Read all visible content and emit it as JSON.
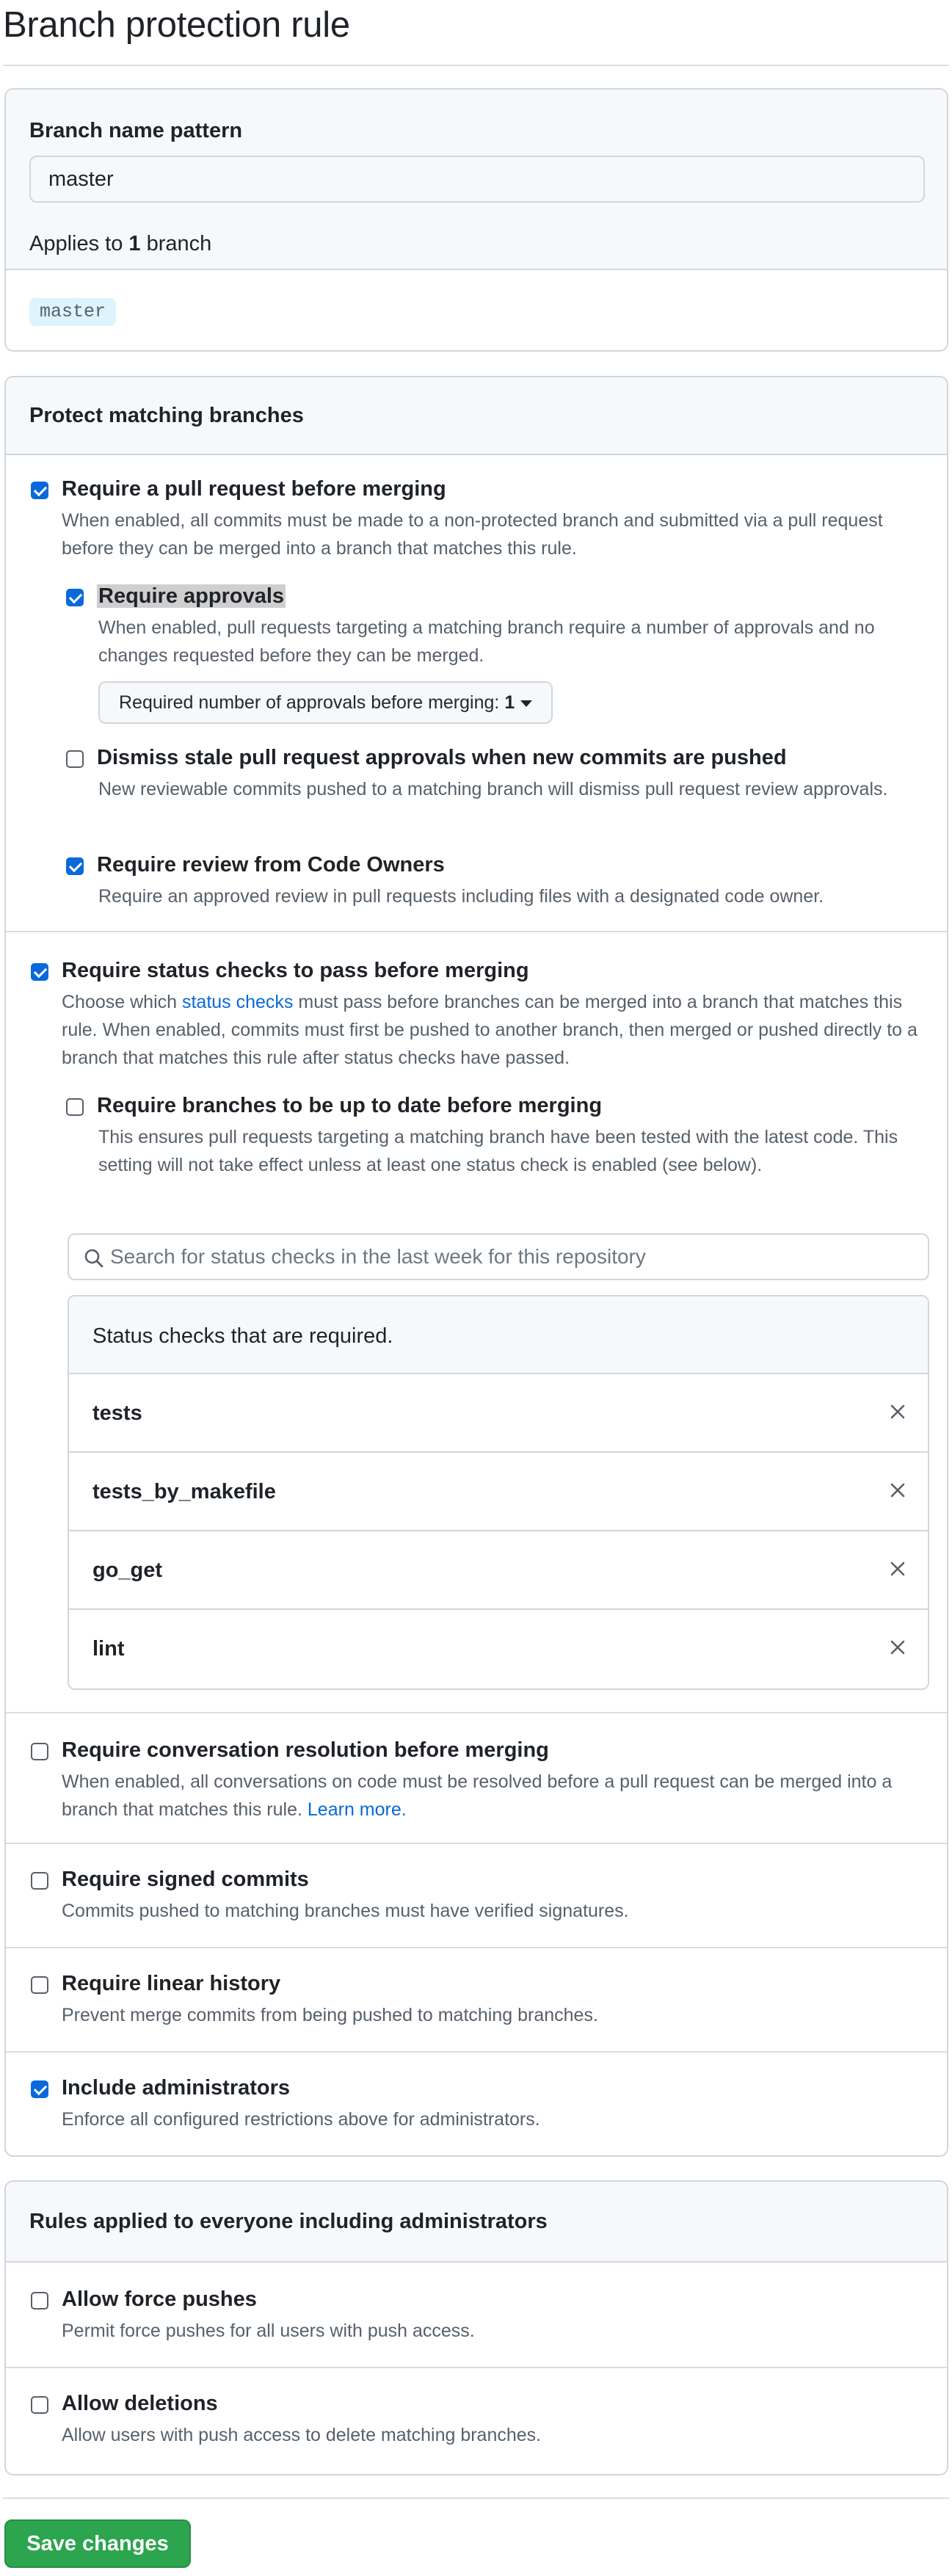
{
  "page": {
    "title": "Branch protection rule"
  },
  "pattern": {
    "heading": "Branch name pattern",
    "value": "master",
    "applies_prefix": "Applies to",
    "applies_count": "1",
    "applies_suffix": "branch",
    "branches": [
      "master"
    ]
  },
  "protect": {
    "heading": "Protect matching branches",
    "require_pr": {
      "checked": true,
      "title": "Require a pull request before merging",
      "desc": "When enabled, all commits must be made to a non-protected branch and submitted via a pull request before they can be merged into a branch that matches this rule."
    },
    "require_approvals": {
      "checked": true,
      "title": "Require approvals",
      "desc": "When enabled, pull requests targeting a matching branch require a number of approvals and no changes requested before they can be merged.",
      "select_label": "Required number of approvals before merging:",
      "select_value": "1"
    },
    "dismiss_stale": {
      "checked": false,
      "title": "Dismiss stale pull request approvals when new commits are pushed",
      "desc": "New reviewable commits pushed to a matching branch will dismiss pull request review approvals."
    },
    "code_owners": {
      "checked": true,
      "title": "Require review from Code Owners",
      "desc": "Require an approved review in pull requests including files with a designated code owner."
    },
    "status_checks": {
      "checked": true,
      "title": "Require status checks to pass before merging",
      "desc_before": "Choose which",
      "desc_link": "status checks",
      "desc_after": "must pass before branches can be merged into a branch that matches this rule. When enabled, commits must first be pushed to another branch, then merged or pushed directly to a branch that matches this rule after status checks have passed."
    },
    "up_to_date": {
      "checked": false,
      "title": "Require branches to be up to date before merging",
      "desc": "This ensures pull requests targeting a matching branch have been tested with the latest code. This setting will not take effect unless at least one status check is enabled (see below)."
    },
    "search": {
      "placeholder": "Search for status checks in the last week for this repository"
    },
    "checks_heading": "Status checks that are required.",
    "checks": [
      "tests",
      "tests_by_makefile",
      "go_get",
      "lint"
    ],
    "conversation": {
      "checked": false,
      "title": "Require conversation resolution before merging",
      "desc": "When enabled, all conversations on code must be resolved before a pull request can be merged into a branch that matches this rule.",
      "link": "Learn more."
    },
    "signed": {
      "checked": false,
      "title": "Require signed commits",
      "desc": "Commits pushed to matching branches must have verified signatures."
    },
    "linear": {
      "checked": false,
      "title": "Require linear history",
      "desc": "Prevent merge commits from being pushed to matching branches."
    },
    "admins": {
      "checked": true,
      "title": "Include administrators",
      "desc": "Enforce all configured restrictions above for administrators."
    }
  },
  "rules": {
    "heading": "Rules applied to everyone including administrators",
    "force_push": {
      "checked": false,
      "title": "Allow force pushes",
      "desc": "Permit force pushes for all users with push access."
    },
    "deletions": {
      "checked": false,
      "title": "Allow deletions",
      "desc": "Allow users with push access to delete matching branches."
    }
  },
  "actions": {
    "save_label": "Save changes"
  },
  "colors": {
    "accent": "#0969da",
    "save": "#2da44e",
    "chip": "#ddf4ff"
  }
}
